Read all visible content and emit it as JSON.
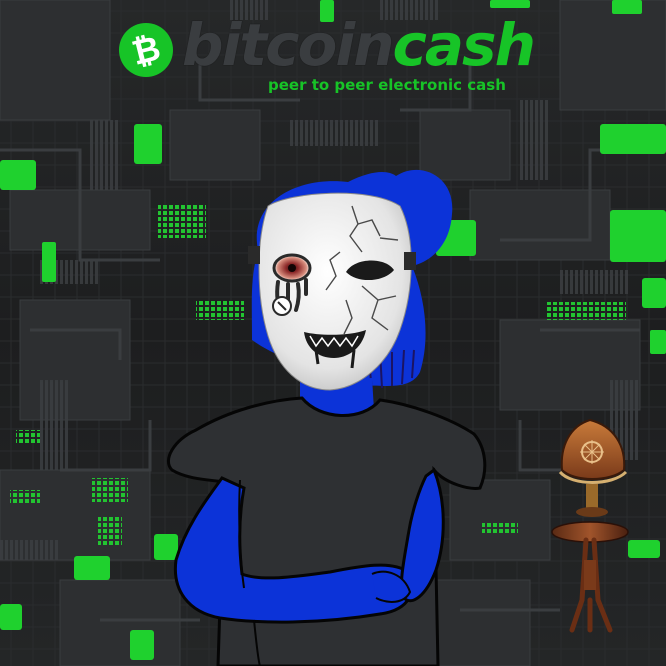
{
  "logo": {
    "word_part1": "bitcoin",
    "word_part2": "cash",
    "tagline": "peer to peer electronic cash",
    "icon": "bitcoin-cash-icon",
    "symbol": "₿"
  },
  "colors": {
    "background": "#1e1f20",
    "circuit": "#2f3133",
    "circuit_light": "#3d4043",
    "accent_green": "#17c427",
    "character_blue": "#0c33d8",
    "mask": "#eeeeee"
  },
  "scene": {
    "character": "masked-figure",
    "props": [
      "antique-table-lamp"
    ]
  }
}
